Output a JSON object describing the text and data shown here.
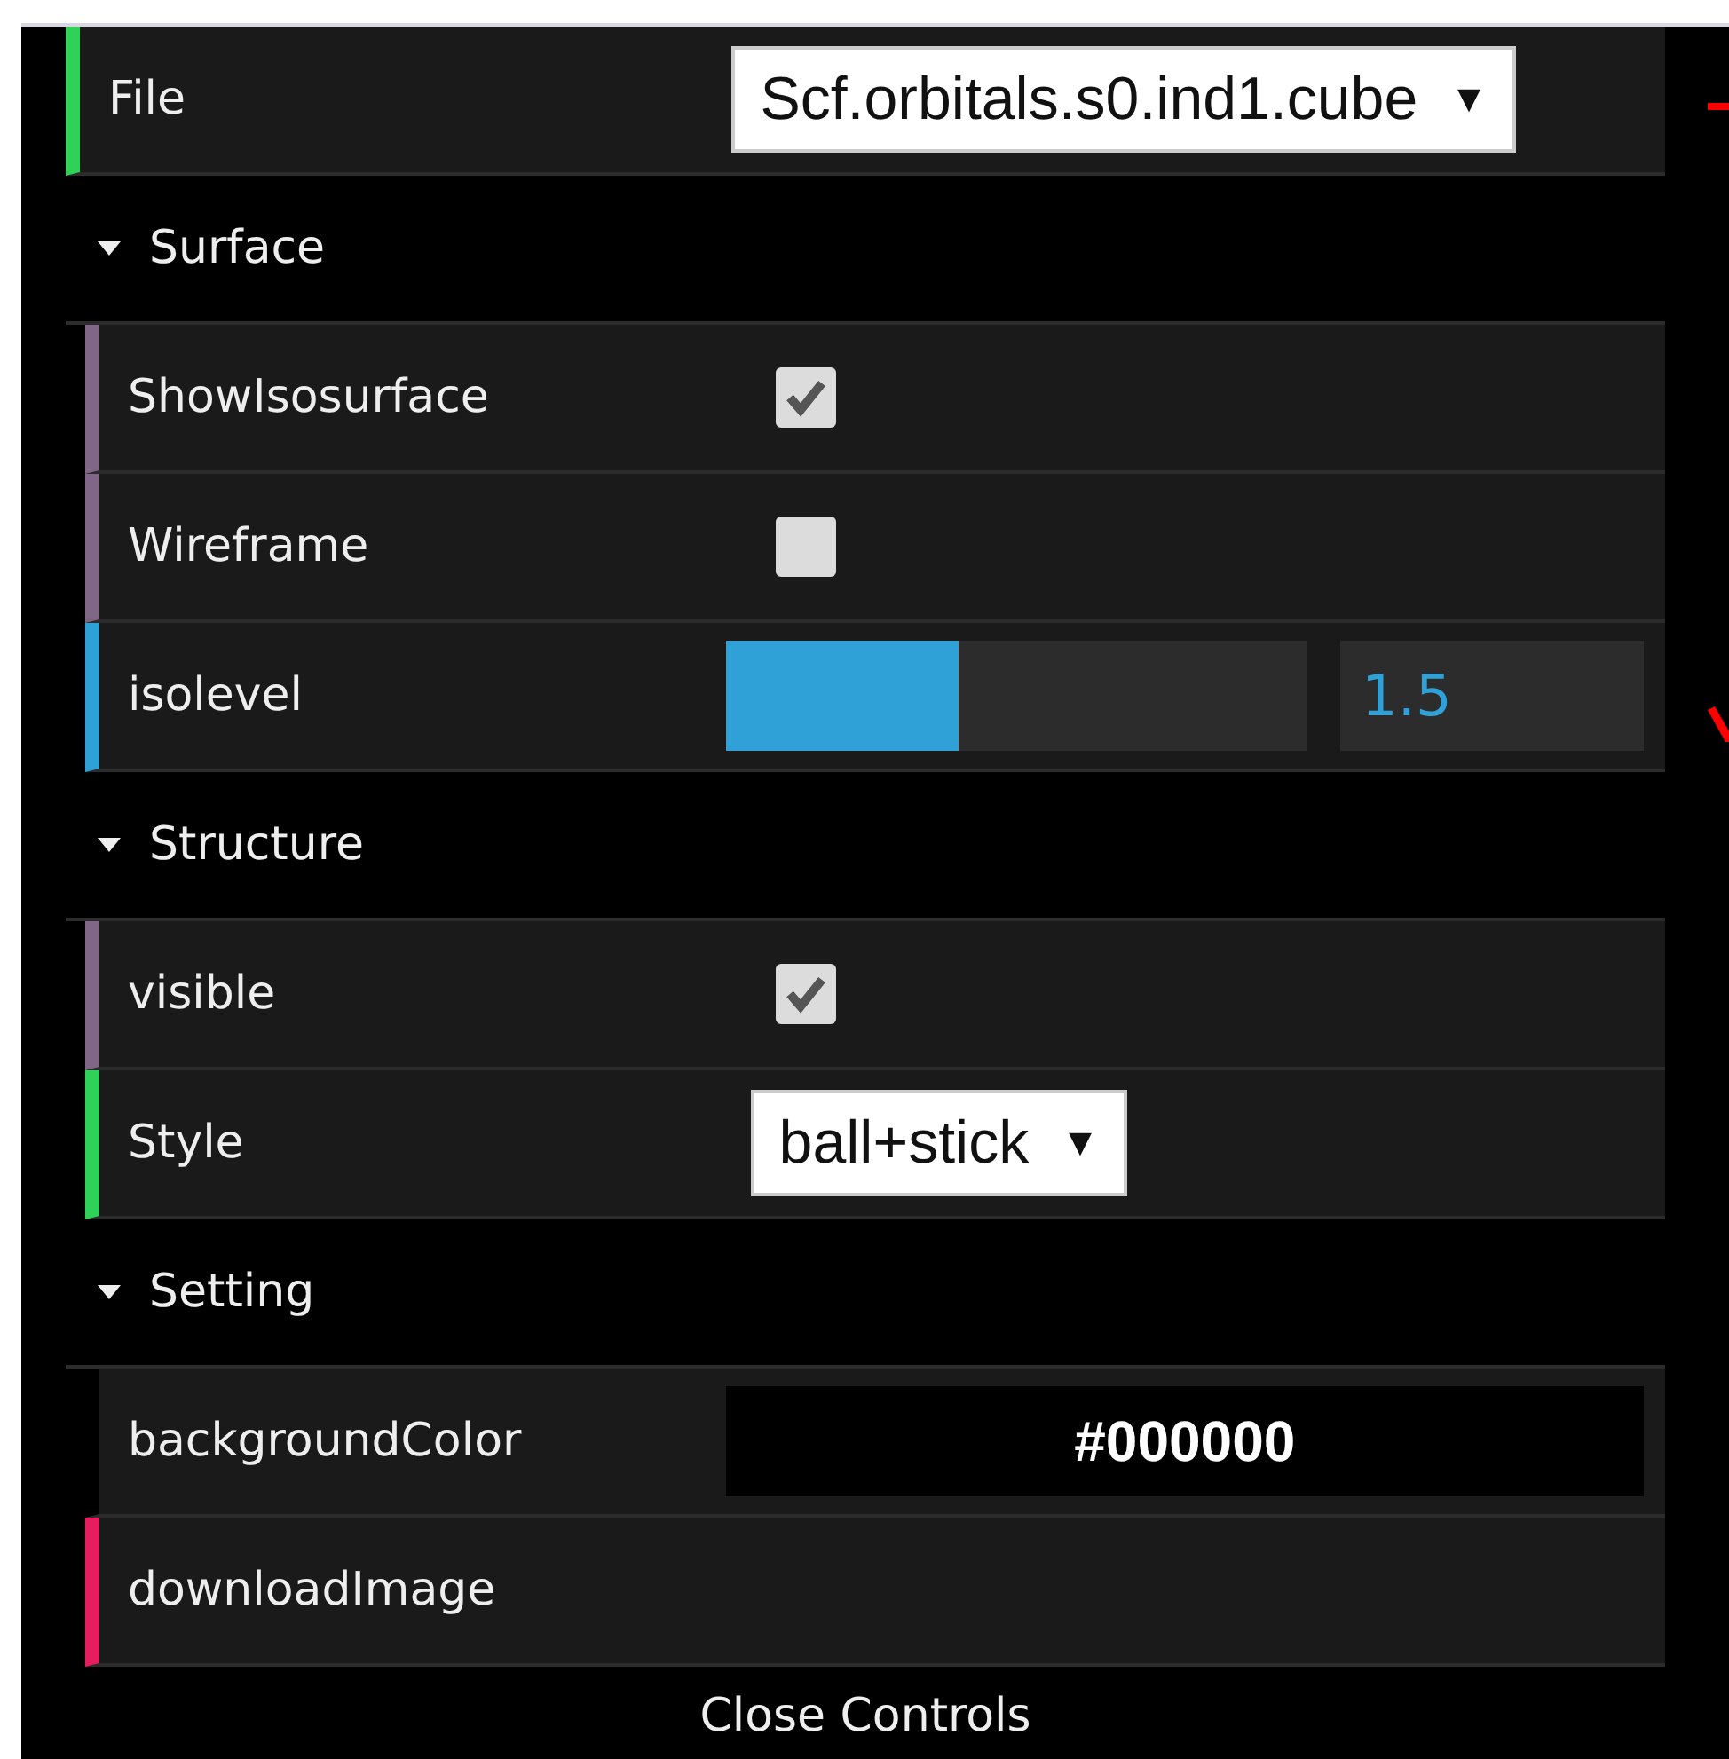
{
  "top_controls": [
    {
      "kind": "select",
      "label": "File",
      "value": "Scf.orbitals.s0.ind1.cube",
      "caret": "▼"
    }
  ],
  "folders": [
    {
      "title": "Surface",
      "expanded": true,
      "controls": [
        {
          "kind": "checkbox",
          "label": "ShowIsosurface",
          "checked": true
        },
        {
          "kind": "checkbox",
          "label": "Wireframe",
          "checked": false
        },
        {
          "kind": "slider",
          "label": "isolevel",
          "level": 0.4,
          "value": "1.5"
        }
      ]
    },
    {
      "title": "Structure",
      "expanded": true,
      "controls": [
        {
          "kind": "checkbox",
          "label": "visible",
          "checked": true
        },
        {
          "kind": "select",
          "label": "Style",
          "value": "ball+stick",
          "caret": "▼"
        }
      ]
    },
    {
      "title": "Setting",
      "expanded": true,
      "controls": [
        {
          "kind": "color",
          "label": "backgroundColor",
          "value": "#000000"
        },
        {
          "kind": "function",
          "label": "downloadImage"
        }
      ]
    }
  ],
  "close_button": "Close Controls"
}
